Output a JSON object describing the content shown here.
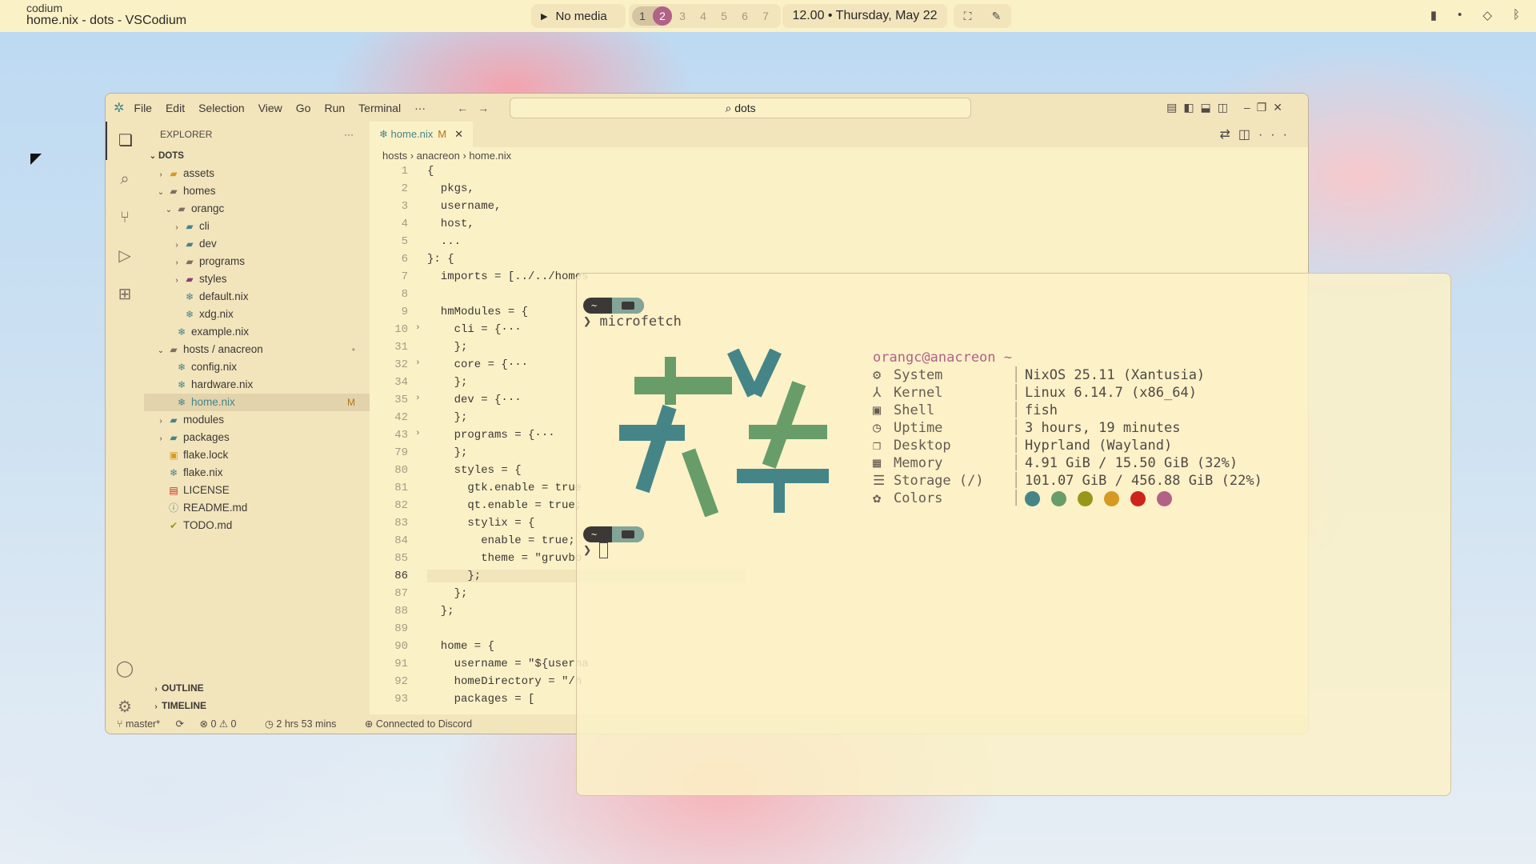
{
  "topbar": {
    "window_class": "codium",
    "window_title": "home.nix - dots - VSCodium",
    "media": "No media",
    "workspaces": [
      "1",
      "2",
      "3",
      "4",
      "5",
      "6",
      "7"
    ],
    "active_workspace": "2",
    "clock": "12.00 • Thursday, May 22"
  },
  "editor": {
    "menu": [
      "File",
      "Edit",
      "Selection",
      "View",
      "Go",
      "Run",
      "Terminal",
      "···"
    ],
    "command_center": "dots",
    "explorer_title": "EXPLORER",
    "root": "DOTS",
    "tree": [
      {
        "depth": 1,
        "type": "folder",
        "open": false,
        "label": "assets",
        "color": "#d79921"
      },
      {
        "depth": 1,
        "type": "folder",
        "open": true,
        "label": "homes",
        "color": "#7c6f64"
      },
      {
        "depth": 2,
        "type": "folder",
        "open": true,
        "label": "orangc",
        "color": "#7c6f64"
      },
      {
        "depth": 3,
        "type": "folder",
        "open": false,
        "label": "cli",
        "color": "#458588"
      },
      {
        "depth": 3,
        "type": "folder",
        "open": false,
        "label": "dev",
        "color": "#458588"
      },
      {
        "depth": 3,
        "type": "folder",
        "open": false,
        "label": "programs",
        "color": "#7c6f64"
      },
      {
        "depth": 3,
        "type": "folder",
        "open": false,
        "label": "styles",
        "color": "#8f3f71"
      },
      {
        "depth": 3,
        "type": "nix",
        "label": "default.nix"
      },
      {
        "depth": 3,
        "type": "nix",
        "label": "xdg.nix"
      },
      {
        "depth": 2,
        "type": "nix",
        "label": "example.nix"
      },
      {
        "depth": 1,
        "type": "folder",
        "open": true,
        "label": "hosts / anacreon",
        "color": "#7c6f64",
        "mark": "•"
      },
      {
        "depth": 2,
        "type": "nix",
        "label": "config.nix"
      },
      {
        "depth": 2,
        "type": "nix",
        "label": "hardware.nix"
      },
      {
        "depth": 2,
        "type": "nix",
        "label": "home.nix",
        "selected": true,
        "mark": "M"
      },
      {
        "depth": 1,
        "type": "folder",
        "open": false,
        "label": "modules",
        "color": "#458588"
      },
      {
        "depth": 1,
        "type": "folder",
        "open": false,
        "label": "packages",
        "color": "#458588"
      },
      {
        "depth": 1,
        "type": "file",
        "label": "flake.lock",
        "icon": "lock-icon",
        "color": "#d79921"
      },
      {
        "depth": 1,
        "type": "nix",
        "label": "flake.nix"
      },
      {
        "depth": 1,
        "type": "file",
        "label": "LICENSE",
        "icon": "license-icon",
        "color": "#cc241d"
      },
      {
        "depth": 1,
        "type": "file",
        "label": "README.md",
        "icon": "info-icon",
        "color": "#458588"
      },
      {
        "depth": 1,
        "type": "file",
        "label": "TODO.md",
        "icon": "check-icon",
        "color": "#98971a"
      }
    ],
    "outline": "OUTLINE",
    "timeline": "TIMELINE",
    "tab": {
      "label": "home.nix",
      "modified": "M"
    },
    "breadcrumbs": [
      "hosts",
      "anacreon",
      "home.nix"
    ],
    "current_line": "86",
    "code": [
      {
        "n": "1",
        "t": "{"
      },
      {
        "n": "2",
        "t": "  pkgs,"
      },
      {
        "n": "3",
        "t": "  username,"
      },
      {
        "n": "4",
        "t": "  host,"
      },
      {
        "n": "5",
        "t": "  ..."
      },
      {
        "n": "6",
        "t": "}: {"
      },
      {
        "n": "7",
        "t": "  imports = [../../homes"
      },
      {
        "n": "8",
        "t": ""
      },
      {
        "n": "9",
        "t": "  hmModules = {"
      },
      {
        "n": "10",
        "t": "    cli = {···",
        "fold": true
      },
      {
        "n": "31",
        "t": "    };"
      },
      {
        "n": "32",
        "t": "    core = {···",
        "fold": true
      },
      {
        "n": "34",
        "t": "    };"
      },
      {
        "n": "35",
        "t": "    dev = {···",
        "fold": true
      },
      {
        "n": "42",
        "t": "    };"
      },
      {
        "n": "43",
        "t": "    programs = {···",
        "fold": true
      },
      {
        "n": "79",
        "t": "    };"
      },
      {
        "n": "80",
        "t": "    styles = {"
      },
      {
        "n": "81",
        "t": "      gtk.enable = true"
      },
      {
        "n": "82",
        "t": "      qt.enable = true;"
      },
      {
        "n": "83",
        "t": "      stylix = {"
      },
      {
        "n": "84",
        "t": "        enable = true;"
      },
      {
        "n": "85",
        "t": "        theme = \"gruvbo"
      },
      {
        "n": "86",
        "t": "      };"
      },
      {
        "n": "87",
        "t": "    };"
      },
      {
        "n": "88",
        "t": "  };"
      },
      {
        "n": "89",
        "t": ""
      },
      {
        "n": "90",
        "t": "  home = {"
      },
      {
        "n": "91",
        "t": "    username = \"${userna"
      },
      {
        "n": "92",
        "t": "    homeDirectory = \"/h"
      },
      {
        "n": "93",
        "t": "    packages = ["
      }
    ],
    "status": {
      "branch": "master*",
      "problems": "0 ⚠ 0",
      "time": "2 hrs 53 mins",
      "discord": "Connected to Discord"
    }
  },
  "terminal": {
    "prompt_tilde": "~",
    "command": "microfetch",
    "user_host": "orangc@anacreon ~",
    "info": [
      {
        "icon": "gear-icon",
        "glyph": "⚙",
        "key": "System",
        "value": "NixOS 25.11 (Xantusia)"
      },
      {
        "icon": "kernel-icon",
        "glyph": "⅄",
        "key": "Kernel",
        "value": "Linux 6.14.7 (x86_64)"
      },
      {
        "icon": "shell-icon",
        "glyph": "▣",
        "key": "Shell",
        "value": "fish"
      },
      {
        "icon": "clock-icon",
        "glyph": "◷",
        "key": "Uptime",
        "value": "3 hours, 19 minutes"
      },
      {
        "icon": "desktop-icon",
        "glyph": "❐",
        "key": "Desktop",
        "value": "Hyprland (Wayland)"
      },
      {
        "icon": "chip-icon",
        "glyph": "▦",
        "key": "Memory",
        "value": "4.91 GiB / 15.50 GiB (32%)"
      },
      {
        "icon": "storage-icon",
        "glyph": "☰",
        "key": "Storage (/)",
        "value": "101.07 GiB / 456.88 GiB (22%)"
      },
      {
        "icon": "palette-icon",
        "glyph": "✿",
        "key": "Colors",
        "value": ""
      }
    ],
    "colors": [
      "#458588",
      "#689d6a",
      "#98971a",
      "#d79921",
      "#cc241d",
      "#b16286"
    ]
  }
}
